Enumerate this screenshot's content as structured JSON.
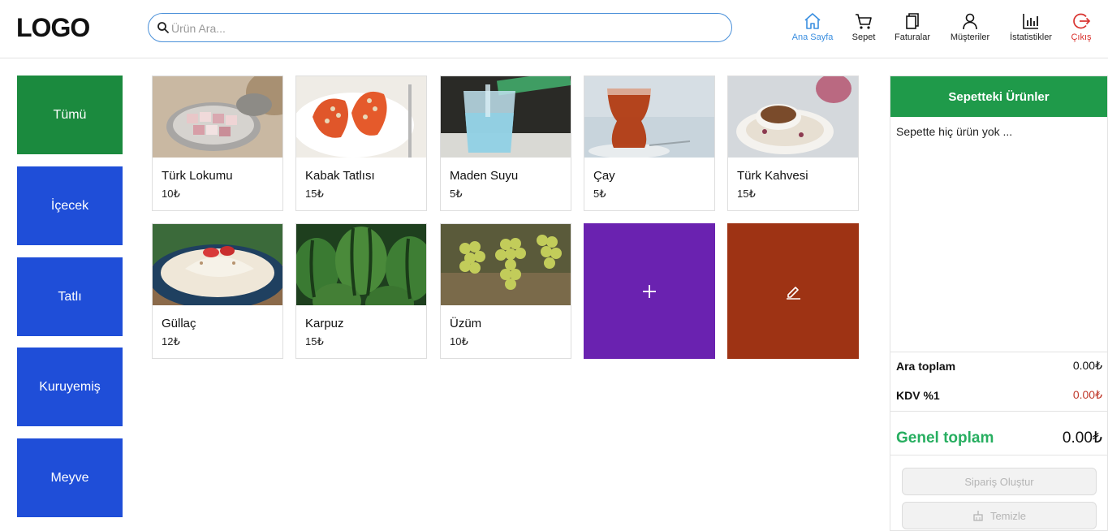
{
  "header": {
    "logo": "LOGO",
    "search_placeholder": "Ürün Ara...",
    "nav": [
      {
        "label": "Ana Sayfa",
        "icon": "home-icon",
        "active": true
      },
      {
        "label": "Sepet",
        "icon": "cart-icon"
      },
      {
        "label": "Faturalar",
        "icon": "invoice-icon"
      },
      {
        "label": "Müşteriler",
        "icon": "user-icon"
      },
      {
        "label": "İstatistikler",
        "icon": "stats-icon"
      },
      {
        "label": "Çıkış",
        "icon": "logout-icon"
      }
    ]
  },
  "categories": [
    {
      "label": "Tümü",
      "active": true
    },
    {
      "label": "İçecek"
    },
    {
      "label": "Tatlı"
    },
    {
      "label": "Kuruyemiş"
    },
    {
      "label": "Meyve"
    }
  ],
  "products": [
    {
      "name": "Türk Lokumu",
      "price": "10₺"
    },
    {
      "name": "Kabak Tatlısı",
      "price": "15₺"
    },
    {
      "name": "Maden Suyu",
      "price": "5₺"
    },
    {
      "name": "Çay",
      "price": "5₺"
    },
    {
      "name": "Türk Kahvesi",
      "price": "15₺"
    },
    {
      "name": "Güllaç",
      "price": "12₺"
    },
    {
      "name": "Karpuz",
      "price": "15₺"
    },
    {
      "name": "Üzüm",
      "price": "10₺"
    }
  ],
  "tiles": {
    "add_icon": "plus-icon",
    "edit_icon": "edit-icon"
  },
  "cart": {
    "title": "Sepetteki Ürünler",
    "empty_text": "Sepette hiç ürün yok ...",
    "subtotal_label": "Ara toplam",
    "subtotal_value": "0.00₺",
    "vat_label": "KDV %1",
    "vat_value": "0.00₺",
    "total_label": "Genel toplam",
    "total_value": "0.00₺",
    "order_button": "Sipariş Oluştur",
    "clear_button": "Temizle"
  },
  "colors": {
    "category_active": "#1b8a3e",
    "category": "#1f4ed8",
    "cart_header": "#1f9a4a",
    "add_tile": "#6a22b0",
    "edit_tile": "#9e3314",
    "nav_active": "#3b8fe0",
    "exit": "#d9322e"
  }
}
